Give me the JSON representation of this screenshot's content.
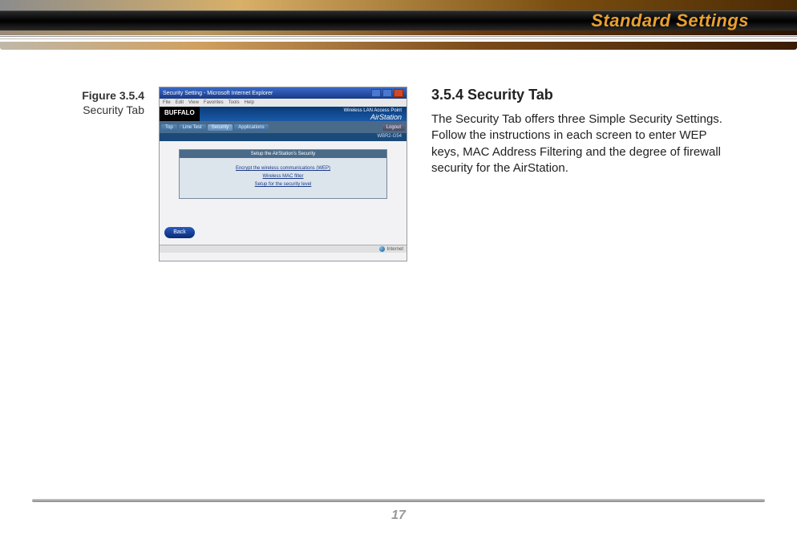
{
  "header": {
    "title": "Standard Settings"
  },
  "figure": {
    "number": "Figure 3.5.4",
    "caption": "Security Tab"
  },
  "screenshot": {
    "browser_title": "Security Setting - Microsoft Internet Explorer",
    "menu": {
      "file": "File",
      "edit": "Edit",
      "view": "View",
      "favorites": "Favorites",
      "tools": "Tools",
      "help": "Help"
    },
    "brand_left": "BUFFALO",
    "brand_ap": "Wireless LAN Access Point",
    "brand_right": "AirStation",
    "tabs": {
      "top": "Top",
      "lantest": "Line Test",
      "security": "Security",
      "applications": "Applications",
      "logout": "Logout"
    },
    "model": "WBR2-G54",
    "panel_title": "Setup the AirStation's Security",
    "links": {
      "l1": "Encrypt the wireless communications (WEP)",
      "l2": "Wireless MAC filter",
      "l3": "Setup for the security level"
    },
    "back": "Back",
    "status": "Internet"
  },
  "section": {
    "heading": "3.5.4 Security Tab",
    "body": "The Security Tab offers three Simple Security Settings. Follow the instructions in each screen to enter WEP keys, MAC Address Filtering and the degree of firewall security for the AirStation."
  },
  "page_number": "17"
}
